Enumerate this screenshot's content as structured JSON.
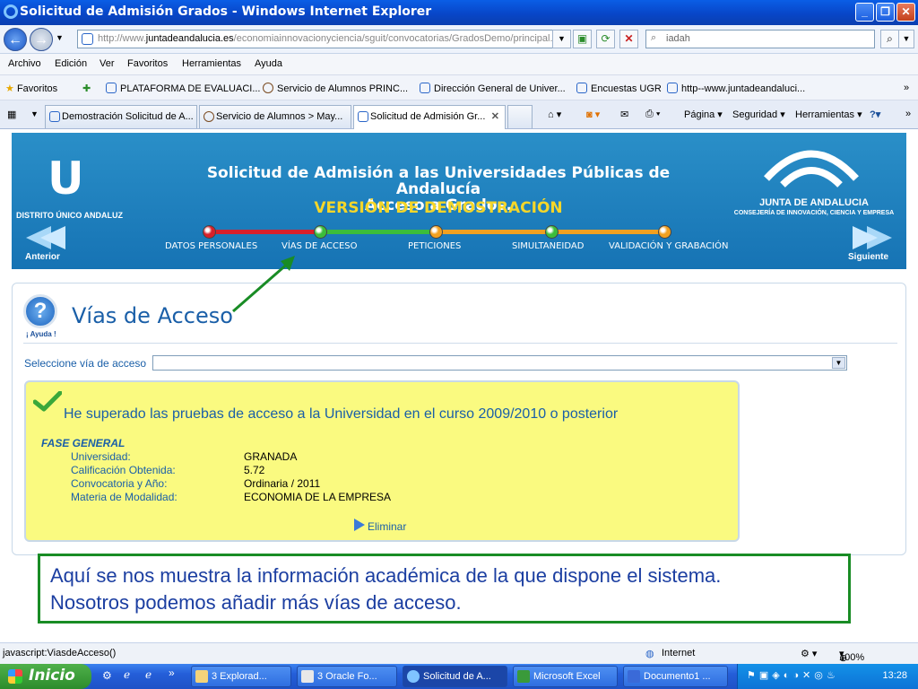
{
  "window": {
    "title": "Solicitud de Admisión Grados - Windows Internet Explorer"
  },
  "address": {
    "url_prefix": "http://www.",
    "url_domain": "juntadeandalucia.es",
    "url_path": "/economiainnovacionyciencia/sguit/convocatorias/GradosDemo/principal.",
    "search_value": "iadah"
  },
  "menu": {
    "items": [
      "Archivo",
      "Edición",
      "Ver",
      "Favoritos",
      "Herramientas",
      "Ayuda"
    ]
  },
  "favorites": {
    "label": "Favoritos",
    "items": [
      "PLATAFORMA DE EVALUACI...",
      "Servicio de Alumnos PRINC...",
      "Dirección General de Univer...",
      "Encuestas UGR",
      "http--www.juntadeandaluci..."
    ],
    "more": "»"
  },
  "tabs": {
    "items": [
      "Demostración Solicitud de A...",
      "Servicio de Alumnos > May...",
      "Solicitud de Admisión Gr..."
    ],
    "close": "✕",
    "tools": [
      "Página ▾",
      "Seguridad ▾",
      "Herramientas ▾"
    ]
  },
  "banner": {
    "title_line1": "Solicitud de Admisión a las Universidades Públicas de Andalucía",
    "title_line2": "Acceso a Grados.",
    "demo": "VERSIÓN DE DEMOSTRACIÓN",
    "distrito": "DISTRITO ÚNICO ANDALUZ",
    "junta": "JUNTA DE ANDALUCIA",
    "consejeria": "CONSEJERÍA DE INNOVACIÓN, CIENCIA Y EMPRESA",
    "prev": "Anterior",
    "next": "Siguiente",
    "steps": [
      "DATOS PERSONALES",
      "VÍAS DE ACCESO",
      "PETICIONES",
      "SIMULTANEIDAD",
      "VALIDACIÓN Y GRABACIÓN"
    ],
    "colors": {
      "dot_red": "#d8202a",
      "dot_green": "#3bbd3b",
      "dot_orange": "#f0a020"
    }
  },
  "content": {
    "help": "¡ Ayuda !",
    "title": "Vías de Acceso",
    "select_label": "Seleccione vía de acceso",
    "select_value": "",
    "heading": "He superado las pruebas de acceso a la Universidad en el curso 2009/2010 o posterior",
    "phase": "FASE GENERAL",
    "rows": [
      {
        "label": "Universidad:",
        "value": "GRANADA"
      },
      {
        "label": "Calificación Obtenida:",
        "value": "5.72"
      },
      {
        "label": "Convocatoria y Año:",
        "value": "Ordinaria / 2011"
      },
      {
        "label": "Materia de Modalidad:",
        "value": "ECONOMIA DE LA EMPRESA"
      }
    ],
    "delete": "Eliminar"
  },
  "callout": {
    "line1": "Aquí se nos muestra la información académica de la que dispone el sistema.",
    "line2": "Nosotros podemos añadir más vías de acceso."
  },
  "status": {
    "left": "javascript:ViasdeAcceso()",
    "zone": "Internet",
    "zoom": "100%"
  },
  "taskbar": {
    "start": "Inicio",
    "tasks": [
      "3 Explorad...",
      "3 Oracle Fo...",
      "Solicitud de A...",
      "Microsoft Excel",
      "Documento1 ..."
    ],
    "clock": "13:28"
  }
}
